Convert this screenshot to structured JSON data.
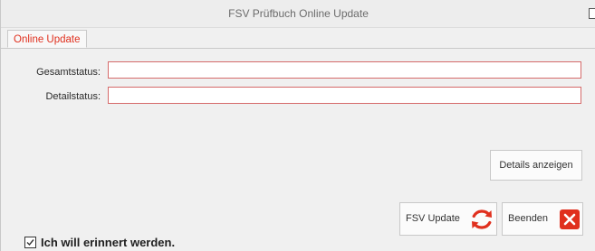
{
  "window": {
    "title": "FSV Prüfbuch Online Update"
  },
  "tabs": [
    {
      "label": "Online Update",
      "active": true
    }
  ],
  "status": {
    "gesamt_label": "Gesamtstatus:",
    "gesamt_value": "",
    "detail_label": "Detailstatus:",
    "detail_value": ""
  },
  "buttons": {
    "details_label": "Details anzeigen",
    "fsv_update_label": "FSV Update",
    "fsv_update_icon": "refresh-icon",
    "beenden_label": "Beenden",
    "beenden_icon": "close-icon"
  },
  "reminder": {
    "label": "Ich will erinnert werden.",
    "checked": true
  },
  "colors": {
    "accent_red": "#e0301e",
    "field_border": "#d56a6a"
  }
}
